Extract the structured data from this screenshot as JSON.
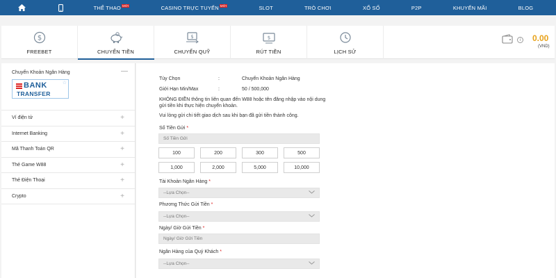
{
  "nav": {
    "items": [
      {
        "label": "THỂ THAO",
        "badge": "MỚI"
      },
      {
        "label": "CASINO TRỰC TUYẾN",
        "badge": "MỚI"
      },
      {
        "label": "SLOT",
        "badge": ""
      },
      {
        "label": "TRÒ CHƠI",
        "badge": ""
      },
      {
        "label": "XỔ SỐ",
        "badge": ""
      },
      {
        "label": "P2P",
        "badge": ""
      },
      {
        "label": "KHUYẾN MÃI",
        "badge": ""
      },
      {
        "label": "BLOG",
        "badge": ""
      }
    ]
  },
  "tabs": [
    {
      "label": "FREEBET",
      "icon": "dollar-circle-icon"
    },
    {
      "label": "CHUYỂN TIỀN",
      "icon": "piggy-bank-icon"
    },
    {
      "label": "CHUYỂN QUỸ",
      "icon": "transfer-icon"
    },
    {
      "label": "RÚT TIỀN",
      "icon": "withdraw-icon"
    },
    {
      "label": "LỊCH SỬ",
      "icon": "history-icon"
    }
  ],
  "balance": {
    "amount": "0.00",
    "currency": "(VND)",
    "info": "i"
  },
  "sidebar": {
    "title": "Chuyển Khoản Ngân Hàng",
    "collapse": "—",
    "logo": {
      "line1": "BANK",
      "line2": "TRANSFER"
    },
    "items": [
      {
        "label": "Ví điện tử"
      },
      {
        "label": "Internet Banking"
      },
      {
        "label": "Mã Thanh Toán QR"
      },
      {
        "label": "Thẻ Game W88"
      },
      {
        "label": "Thẻ Điện Thoại"
      },
      {
        "label": "Crypto"
      }
    ],
    "expand": "+"
  },
  "main": {
    "option_label": "Tùy Chọn",
    "option_value": "Chuyển Khoản Ngân Hàng",
    "limit_label": "Giới Hạn Min/Max",
    "limit_value": "50 / 500,000",
    "colon": ":",
    "note1": "KHÔNG ĐIỀN thông tin liên quan đến W88 hoặc tên đăng nhập vào nội dung gửi tiền khi thực hiện chuyển khoản.",
    "note2": "Vui lòng gửi chi tiết giao dịch sau khi bạn đã gửi tiền thành công.",
    "required": "*",
    "amount_label": "Số Tiền Gửi",
    "amount_placeholder": "Số Tiền Gửi",
    "quick_amounts": [
      "100",
      "200",
      "300",
      "500",
      "1,000",
      "2,000",
      "5,000",
      "10,000"
    ],
    "bank_account_label": "Tài Khoản Ngân Hàng",
    "method_label": "Phương Thức Gửi Tiền",
    "datetime_label": "Ngày/ Giờ Gửi Tiền",
    "datetime_placeholder": "Ngày/ Giờ Gửi Tiền",
    "customer_bank_label": "Ngân Hàng của Quý Khách",
    "select_placeholder": "--Lựa Chọn--"
  }
}
